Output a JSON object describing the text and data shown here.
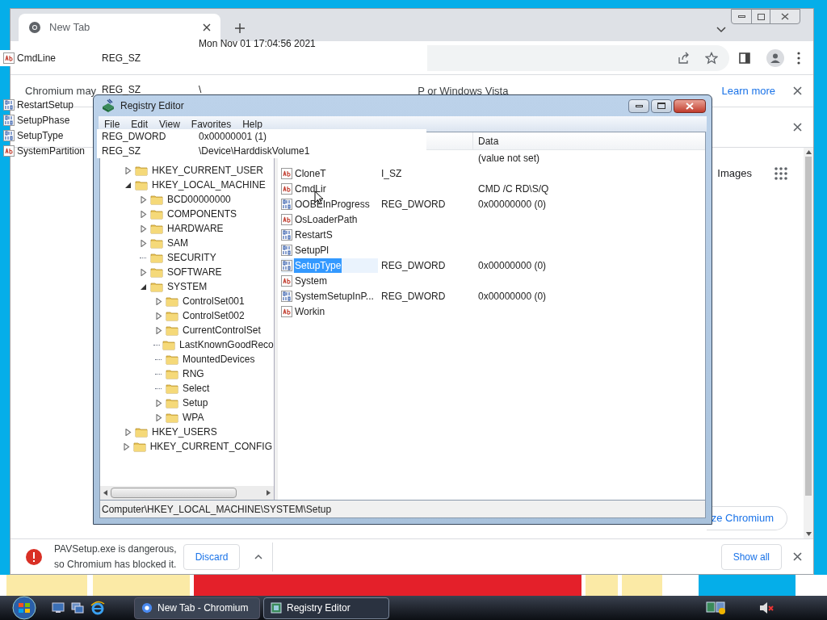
{
  "chrome": {
    "tab": {
      "title": "New Tab",
      "selected": true
    },
    "infobar": {
      "text_start": "Chromium may",
      "text_end": "P or Windows Vista",
      "link": "Learn more"
    },
    "shortcuts": {
      "images": "Images"
    },
    "customize": "ze Chromium",
    "download": {
      "line1": "PAVSetup.exe is dangerous,",
      "line2": "so Chromium has blocked it.",
      "discard": "Discard",
      "show_all": "Show all"
    }
  },
  "overlay": {
    "clock": "Mon Nov 01 17:04:56 2021",
    "top_rows": [
      {
        "kind": "string",
        "name": "CmdLine",
        "type": "REG_SZ"
      },
      {
        "kind": "none",
        "type": "REG_SZ",
        "data": "\\"
      }
    ],
    "side_names": [
      {
        "kind": "binary",
        "name": "RestartSetup"
      },
      {
        "kind": "binary",
        "name": "SetupPhase"
      },
      {
        "kind": "binary",
        "name": "SetupType"
      },
      {
        "kind": "string",
        "name": "SystemPartition"
      }
    ],
    "band_rows": [
      {
        "type": "REG_DWORD",
        "data": "0x00000001 (1)"
      },
      {
        "type": "REG_SZ",
        "data": "\\Device\\HarddiskVolume1"
      }
    ]
  },
  "regedit": {
    "title": "Registry Editor",
    "menu": [
      "File",
      "Edit",
      "View",
      "Favorites",
      "Help"
    ],
    "tree": [
      {
        "label": "HKEY_CURRENT_USER",
        "expandable": true,
        "expanded": false
      },
      {
        "label": "HKEY_LOCAL_MACHINE",
        "expandable": true,
        "expanded": true,
        "children": [
          {
            "label": "BCD00000000",
            "expandable": true,
            "expanded": false
          },
          {
            "label": "COMPONENTS",
            "expandable": true,
            "expanded": false
          },
          {
            "label": "HARDWARE",
            "expandable": true,
            "expanded": false
          },
          {
            "label": "SAM",
            "expandable": true,
            "expanded": false
          },
          {
            "label": "SECURITY",
            "expandable": false
          },
          {
            "label": "SOFTWARE",
            "expandable": true,
            "expanded": false
          },
          {
            "label": "SYSTEM",
            "expandable": true,
            "expanded": true,
            "children": [
              {
                "label": "ControlSet001",
                "expandable": true,
                "expanded": false
              },
              {
                "label": "ControlSet002",
                "expandable": true,
                "expanded": false
              },
              {
                "label": "CurrentControlSet",
                "expandable": true,
                "expanded": false
              },
              {
                "label": "LastKnownGoodReco",
                "expandable": false
              },
              {
                "label": "MountedDevices",
                "expandable": false
              },
              {
                "label": "RNG",
                "expandable": false
              },
              {
                "label": "Select",
                "expandable": false
              },
              {
                "label": "Setup",
                "expandable": true,
                "expanded": false
              },
              {
                "label": "WPA",
                "expandable": true,
                "expanded": false
              }
            ]
          }
        ]
      },
      {
        "label": "HKEY_USERS",
        "expandable": true,
        "expanded": false
      },
      {
        "label": "HKEY_CURRENT_CONFIG",
        "expandable": true,
        "expanded": false
      }
    ],
    "data_header": "Data",
    "values": [
      {
        "data": "(value not set)"
      },
      {
        "kind": "string",
        "name": "CloneT",
        "type": "I_SZ",
        "selected": false
      },
      {
        "kind": "string",
        "name": "CmdLir",
        "data": "CMD /C RD\\S/Q",
        "selected": false
      },
      {
        "kind": "binary",
        "name": "OOBEInProgress",
        "type": "REG_DWORD",
        "data": "0x00000000 (0)",
        "selected": false
      },
      {
        "kind": "string",
        "name": "OsLoaderPath",
        "selected": false
      },
      {
        "kind": "binary",
        "name": "RestartS",
        "selected": false
      },
      {
        "kind": "binary",
        "name": "SetupPl",
        "selected": false
      },
      {
        "kind": "binary",
        "name": "SetupType",
        "type": "REG_DWORD",
        "data": "0x00000000 (0)",
        "selected": true
      },
      {
        "kind": "string",
        "name": "System",
        "selected": false
      },
      {
        "kind": "binary",
        "name": "SystemSetupInP...",
        "type": "REG_DWORD",
        "data": "0x00000000 (0)",
        "selected": false
      },
      {
        "kind": "string",
        "name": "Workin",
        "selected": false
      }
    ],
    "status": "Computer\\HKEY_LOCAL_MACHINE\\SYSTEM\\Setup"
  },
  "taskbar": {
    "buttons": [
      {
        "label": "New Tab - Chromium",
        "kind": "chrome",
        "selected": false
      },
      {
        "label": "Registry Editor",
        "kind": "regedit",
        "selected": true
      }
    ]
  }
}
